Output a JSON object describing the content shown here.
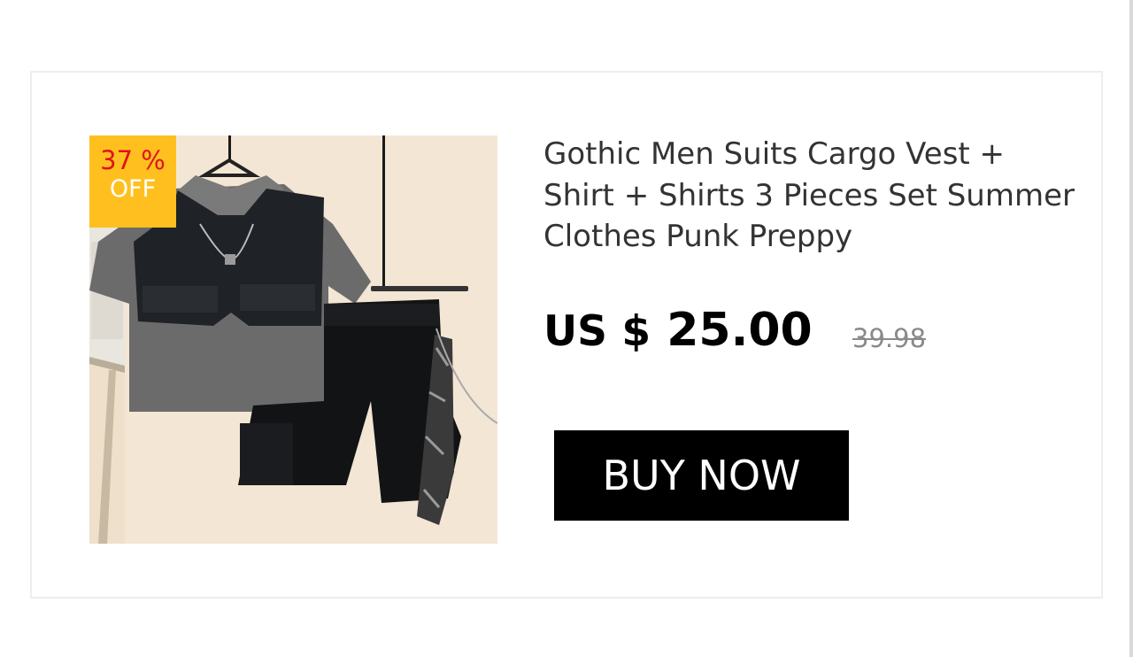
{
  "product": {
    "title": "Gothic Men Suits Cargo Vest + Shirt + Shirts 3 Pieces Set Summer Clothes Punk Preppy",
    "image_icon": "clothing-set-photo",
    "discount": {
      "percent_label": "37 %",
      "off_label": "OFF",
      "badge_color": "#ffc01f",
      "percent_color": "#e0121b"
    },
    "price": {
      "currency_label": "US $",
      "value": "25.00",
      "original": "39.98"
    },
    "buy_label": "BUY NOW"
  },
  "colors": {
    "button": "#000000",
    "title_text": "#333333",
    "old_price": "#8a8a8a"
  }
}
